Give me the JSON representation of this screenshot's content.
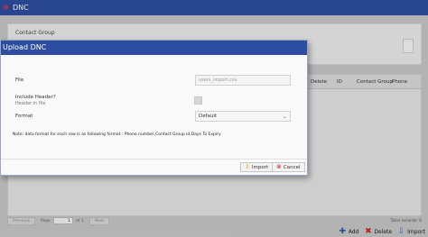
{
  "window": {
    "title": "DNC"
  },
  "filter": {
    "label": "Contact Group"
  },
  "grid": {
    "columns": [
      "Delete",
      "ID",
      "Contact Group",
      "Phone"
    ]
  },
  "pager": {
    "previous": "Previous",
    "page_label": "Page",
    "page_value": "1",
    "of_label": "of 1",
    "next": "Next",
    "total": "Total records: 0"
  },
  "actions": {
    "add": "Add",
    "delete": "Delete",
    "import": "Import"
  },
  "dialog": {
    "title": "Upload DNC",
    "file_label": "File",
    "file_placeholder": "users_import.csv",
    "include_header_label": "Include Header?",
    "include_header_sub": "Header in file",
    "format_label": "Format",
    "format_value": "Default",
    "note": "Note: data format for each row is as following format : Phone number,Contact Group id,Days To Expiry",
    "import_button": "Import",
    "cancel_button": "Cancel"
  },
  "colors": {
    "header_bg": "#2d4da0",
    "delete_icon": "#c62828",
    "add_icon": "#2d5ca8"
  },
  "icons": {
    "app": "app-logo-icon",
    "add": "plus-icon",
    "delete": "x-icon",
    "import": "import-icon",
    "cancel": "cancel-icon"
  }
}
